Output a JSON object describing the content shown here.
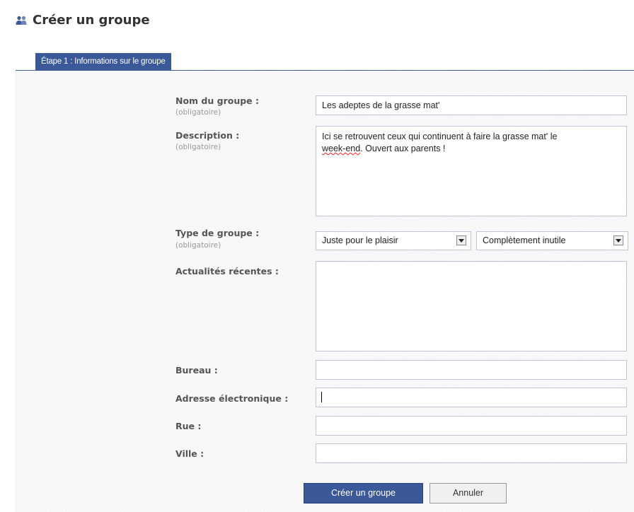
{
  "header": {
    "title": "Créer un groupe",
    "icon": "group-icon"
  },
  "tab": {
    "label": "Étape 1 : Informations sur le groupe",
    "color": "#3b5998"
  },
  "form": {
    "name": {
      "label": "Nom du groupe :",
      "required": "(obligatoire)",
      "value": "Les adeptes de la grasse mat'"
    },
    "description": {
      "label": "Description :",
      "required": "(obligatoire)",
      "value_line1": "Ici se retrouvent ceux qui continuent à faire la grasse mat' le",
      "value_misspelled": "week-end",
      "value_line2_rest": ". Ouvert aux parents !"
    },
    "group_type": {
      "label": "Type de groupe :",
      "required": "(obligatoire)",
      "category": "Juste pour le plaisir",
      "subcategory": "Complètement inutile"
    },
    "news": {
      "label": "Actualités récentes :",
      "value": ""
    },
    "office": {
      "label": "Bureau :",
      "value": ""
    },
    "email": {
      "label": "Adresse électronique :",
      "value": ""
    },
    "street": {
      "label": "Rue :",
      "value": ""
    },
    "city": {
      "label": "Ville :",
      "value": ""
    }
  },
  "buttons": {
    "create": "Créer un groupe",
    "cancel": "Annuler"
  }
}
